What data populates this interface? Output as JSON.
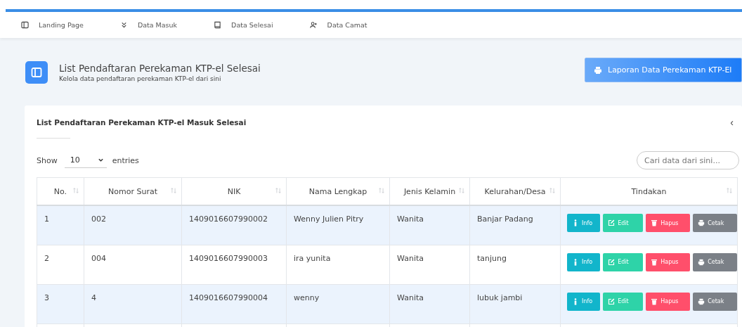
{
  "nav": [
    {
      "label": "Landing Page"
    },
    {
      "label": "Data Masuk"
    },
    {
      "label": "Data Selesai"
    },
    {
      "label": "Data Camat"
    }
  ],
  "header": {
    "title": "List Pendaftaran Perekaman KTP-el Selesai",
    "subtitle": "Kelola data pendaftaran perekaman KTP-el dari sini",
    "report_button": "Laporan Data Perekaman KTP-El"
  },
  "card": {
    "title": "List Pendaftaran Perekaman KTP-el Masuk Selesai",
    "collapse": "‹"
  },
  "length": {
    "show": "Show",
    "value": "10",
    "entries": "entries"
  },
  "search": {
    "placeholder": "Cari data dari sini..."
  },
  "table": {
    "columns": [
      "No.",
      "Nomor Surat",
      "NIK",
      "Nama Lengkap",
      "Jenis Kelamin",
      "Kelurahan/Desa",
      "Tindakan"
    ],
    "rows": [
      {
        "cells": [
          "1",
          "002",
          "1409016607990002",
          "Wenny Julien Pitry",
          "Wanita",
          "Banjar Padang"
        ],
        "actions": [
          {
            "label": "Info",
            "kind": "info"
          },
          {
            "label": "Edit",
            "kind": "edit"
          },
          {
            "label": "Hapus",
            "kind": "delete"
          },
          {
            "label": "Cetak",
            "kind": "print"
          }
        ]
      },
      {
        "cells": [
          "2",
          "004",
          "1409016607990003",
          "ira yunita",
          "Wanita",
          "tanjung"
        ],
        "actions": [
          {
            "label": "Info",
            "kind": "info"
          },
          {
            "label": "Edit",
            "kind": "edit"
          },
          {
            "label": "Hapus",
            "kind": "delete"
          },
          {
            "label": "Cetak",
            "kind": "print"
          }
        ]
      },
      {
        "cells": [
          "3",
          "4",
          "1409016607990004",
          "wenny",
          "Wanita",
          "lubuk jambi"
        ],
        "actions": [
          {
            "label": "Info",
            "kind": "info"
          },
          {
            "label": "Edit",
            "kind": "edit"
          },
          {
            "label": "Hapus",
            "kind": "delete"
          },
          {
            "label": "Cetak",
            "kind": "print"
          }
        ]
      }
    ]
  }
}
